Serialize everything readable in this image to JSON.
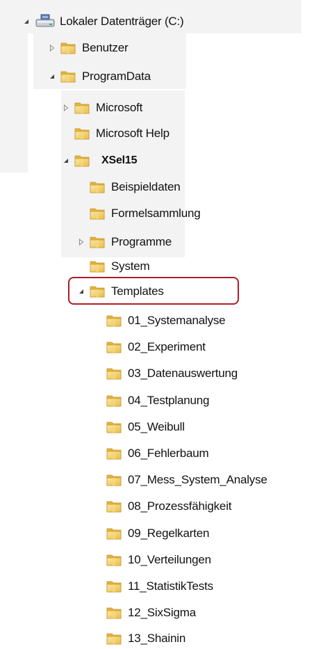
{
  "tree": {
    "drive": {
      "label": "Lokaler Datenträger (C:)",
      "icon": "drive-icon",
      "expanded": true
    },
    "benutzer": {
      "label": "Benutzer",
      "expanded": false
    },
    "programdata": {
      "label": "ProgramData",
      "expanded": true
    },
    "microsoft": {
      "label": "Microsoft",
      "expanded": false
    },
    "microsoft_help": {
      "label": "Microsoft Help"
    },
    "xsel15": {
      "label": "XSel15",
      "expanded": true
    },
    "beispieldaten": {
      "label": "Beispieldaten"
    },
    "formelsammlung": {
      "label": "Formelsammlung"
    },
    "programme": {
      "label": "Programme",
      "expanded": false
    },
    "system": {
      "label": "System"
    },
    "templates": {
      "label": "Templates",
      "expanded": true,
      "highlighted": true
    },
    "template_folders": [
      "01_Systemanalyse",
      "02_Experiment",
      "03_Datenauswertung",
      "04_Testplanung",
      "05_Weibull",
      "06_Fehlerbaum",
      "07_Mess_System_Analyse",
      "08_Prozessfähigkeit",
      "09_Regelkarten",
      "10_Verteilungen",
      "11_StatistikTests",
      "12_SixSigma",
      "13_Shainin"
    ]
  },
  "colors": {
    "highlight_border": "#b01c28",
    "band": "#f3f3f3",
    "folder_light": "#f7d77a",
    "folder_dark": "#e2b43c"
  }
}
